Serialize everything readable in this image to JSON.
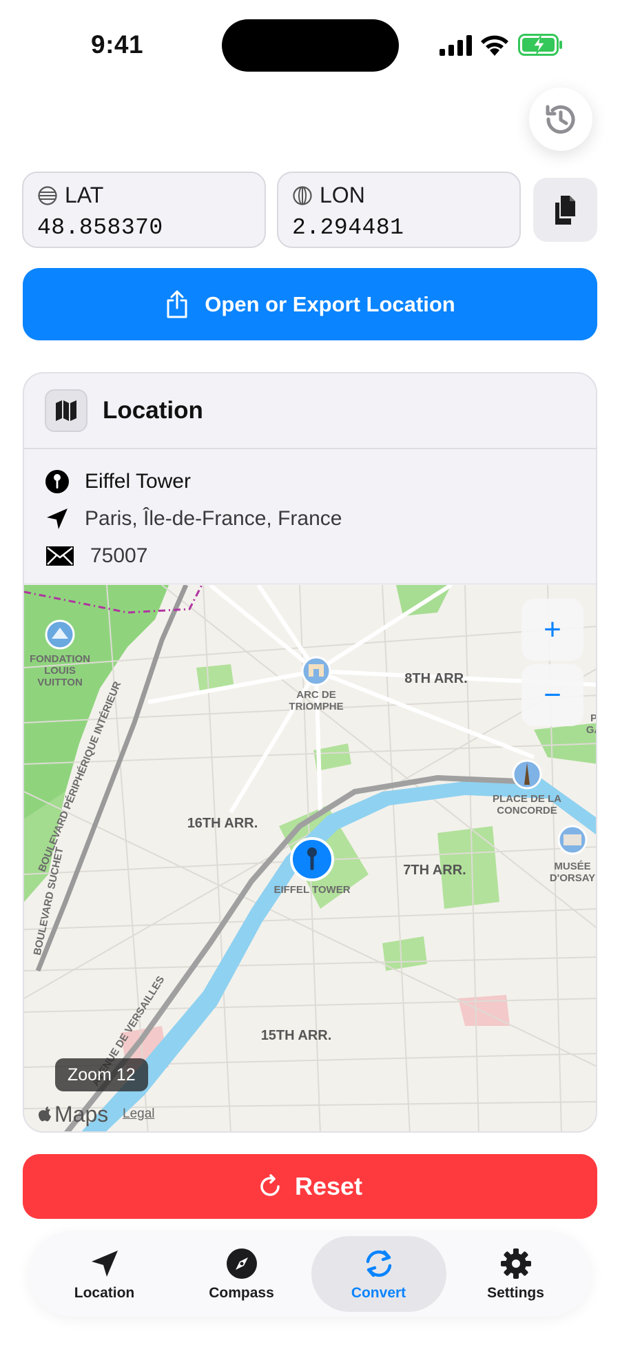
{
  "status_bar": {
    "time": "9:41"
  },
  "coordinates": {
    "lat": {
      "label": "LAT",
      "value": "48.858370"
    },
    "lon": {
      "label": "LON",
      "value": "2.294481"
    }
  },
  "export_button": {
    "label": "Open or Export Location"
  },
  "location_card": {
    "title": "Location",
    "place_name": "Eiffel Tower",
    "region": "Paris, Île-de-France, France",
    "postal_code": "75007"
  },
  "map": {
    "zoom_label": "Zoom 12",
    "zoom_in": "+",
    "zoom_out": "−",
    "attribution": "Maps",
    "legal": "Legal",
    "labels": {
      "fondation": "FONDATION\nLOUIS\nVUITTON",
      "arc": "ARC DE\nTRIOMPHE",
      "arr8": "8TH ARR.",
      "concorde": "PLACE DE LA\nCONCORDE",
      "arr16": "16TH ARR.",
      "eiffel": "EIFFEL TOWER",
      "arr7": "7TH ARR.",
      "orsay": "MUSÉE\nD'ORSAY",
      "arr15": "15TH ARR.",
      "periph": "BOULEVARD PÉRIPHÉRIQUE INTÉRIEUR",
      "suchet": "BOULEVARD SUCHET",
      "versailles": "AVENUE DE VERSAILLES",
      "edge_p": "P",
      "edge_ga": "GA"
    }
  },
  "reset_button": {
    "label": "Reset"
  },
  "tabs": [
    {
      "label": "Location"
    },
    {
      "label": "Compass"
    },
    {
      "label": "Convert"
    },
    {
      "label": "Settings"
    }
  ],
  "colors": {
    "accent": "#0a84ff",
    "danger": "#ff3a3f",
    "battery": "#34c759"
  }
}
